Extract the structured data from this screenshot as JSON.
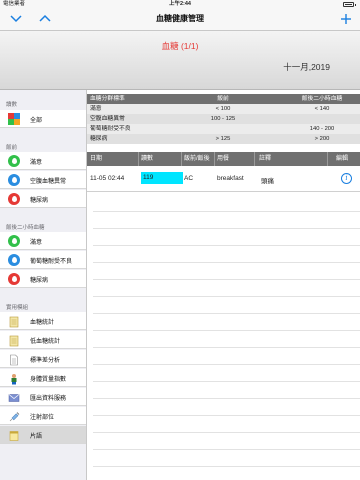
{
  "status": {
    "carrier": "電信業者",
    "time": "上午2:44"
  },
  "nav": {
    "title": "血糖健康管理",
    "add_label": "+"
  },
  "header": {
    "title": "血糖 (1/1)",
    "date": "十一月,2019"
  },
  "sidebar": {
    "sections": [
      {
        "title": "讀數",
        "items": [
          {
            "label": "全部",
            "icon": "all-quadrant-icon"
          }
        ]
      },
      {
        "title": "飯前",
        "items": [
          {
            "label": "滿意",
            "icon": "green-drop-icon"
          },
          {
            "label": "空腹血糖異常",
            "icon": "blue-drop-icon"
          },
          {
            "label": "糖尿病",
            "icon": "red-drop-icon"
          }
        ]
      },
      {
        "title": "飯後二小時血糖",
        "items": [
          {
            "label": "滿意",
            "icon": "green-drop-icon"
          },
          {
            "label": "葡萄糖耐受不良",
            "icon": "blue-drop-icon"
          },
          {
            "label": "糖尿病",
            "icon": "red-drop-icon"
          }
        ]
      },
      {
        "title": "實用模組",
        "items": [
          {
            "label": "血糖統計",
            "icon": "notebook-icon"
          },
          {
            "label": "低血糖統計",
            "icon": "notebook-icon"
          },
          {
            "label": "標準差分析",
            "icon": "document-icon"
          },
          {
            "label": "身體質量指數",
            "icon": "person-icon"
          },
          {
            "label": "匯出資料服務",
            "icon": "mail-icon"
          },
          {
            "label": "注射部位",
            "icon": "syringe-icon"
          },
          {
            "label": "片語",
            "icon": "notes-icon"
          }
        ]
      }
    ]
  },
  "reference": {
    "headers": [
      "血糖分群標準",
      "飯前",
      "飯後二小時血糖"
    ],
    "rows": [
      [
        "滿意",
        "< 100",
        "< 140"
      ],
      [
        "空腹血糖異常",
        "100 - 125",
        ""
      ],
      [
        "葡萄糖耐受不良",
        "",
        "140 - 200"
      ],
      [
        "糖尿病",
        "> 125",
        "> 200"
      ]
    ]
  },
  "records": {
    "headers": [
      "日期",
      "讀數",
      "飯前/飯後",
      "用餐",
      "註釋",
      "編輯"
    ],
    "rows": [
      {
        "date": "11-05  02:44",
        "value": "119",
        "timing": "AC",
        "meal": "breakfast",
        "note": "頭痛"
      }
    ]
  },
  "colors": {
    "accent": "#1a7fe0",
    "highlight": "#00e5ff",
    "title_red": "#e53935"
  }
}
